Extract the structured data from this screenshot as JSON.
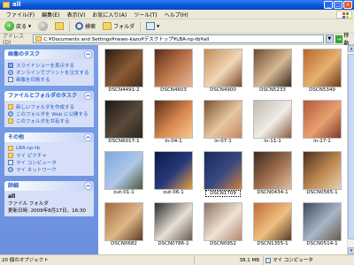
{
  "window": {
    "title": "all"
  },
  "menu": [
    "ファイル(F)",
    "編集(E)",
    "表示(V)",
    "お気に入り(A)",
    "ツール(T)",
    "ヘルプ(H)"
  ],
  "toolbar": {
    "back": "戻る",
    "search": "検索",
    "folders": "フォルダ"
  },
  "address": {
    "label": "アドレス(D)",
    "path": "C:¥Documents and Settings¥newo-kazu¥デスクトップ¥LBA-np-tb¥all",
    "go": "移動"
  },
  "sidebar": {
    "image_tasks": {
      "title": "画像のタスク",
      "items": [
        "スライドショーを表示する",
        "オンラインでプリントを注文する",
        "画像を印刷する"
      ]
    },
    "file_tasks": {
      "title": "ファイルとフォルダのタスク",
      "items": [
        "新しいフォルダを作成する",
        "このフォルダを Web に公開する",
        "このフォルダを共有する"
      ]
    },
    "other": {
      "title": "その他",
      "items": [
        "LBA-np-tb",
        "マイ ピクチャ",
        "マイ コンピュータ",
        "マイ ネットワーク"
      ]
    },
    "details": {
      "title": "詳細",
      "name": "all",
      "type": "ファイル フォルダ",
      "modified": "更新日時: 2009年8月17日、16:30"
    }
  },
  "files": [
    {
      "name": "DSCN4491-2",
      "colors": [
        "#2a1d14",
        "#8a5a34",
        "#4a2c1a"
      ]
    },
    {
      "name": "DSCN4603",
      "colors": [
        "#5a2b18",
        "#c27a4e",
        "#e2b99a"
      ]
    },
    {
      "name": "DSCN4900",
      "colors": [
        "#c28a55",
        "#f0d8b8",
        "#7a4b2a"
      ]
    },
    {
      "name": "DSCN5233",
      "colors": [
        "#6f4a30",
        "#d6b892",
        "#3a2a20"
      ]
    },
    {
      "name": "DSCN5349",
      "colors": [
        "#b7672e",
        "#e8b070",
        "#6a3a1c"
      ]
    },
    {
      "name": "DSCN6017-1",
      "colors": [
        "#1a1a1a",
        "#5a4a3a",
        "#2a2420"
      ]
    },
    {
      "name": "in-04-1",
      "colors": [
        "#5a2b18",
        "#d88a50",
        "#f4c890"
      ]
    },
    {
      "name": "in-07-1",
      "colors": [
        "#7a5030",
        "#e8c8a0",
        "#c08860"
      ]
    },
    {
      "name": "in-11-1",
      "colors": [
        "#c0b8b0",
        "#f0ece6",
        "#8a5a40"
      ]
    },
    {
      "name": "in-17-1",
      "colors": [
        "#b05a3a",
        "#e8a070",
        "#7a3a2a"
      ]
    },
    {
      "name": "out-01-1",
      "colors": [
        "#7aa8e0",
        "#b0c8e8",
        "#4a5a3a"
      ]
    },
    {
      "name": "out-06-1",
      "colors": [
        "#0a1a4a",
        "#2a3a7a",
        "#e8a040"
      ]
    },
    {
      "name": "DSCN1709",
      "colors": [
        "#1a2a5a",
        "#3a4a80",
        "#d08040"
      ]
    },
    {
      "name": "DSCN0434-1",
      "colors": [
        "#3a2a20",
        "#a07050",
        "#e0c0a0"
      ]
    },
    {
      "name": "DSCN0565-1",
      "colors": [
        "#4a3020",
        "#c08a50",
        "#e8d0b0"
      ]
    },
    {
      "name": "DSCN0682",
      "colors": [
        "#a06840",
        "#e0b888",
        "#5a3a24"
      ]
    },
    {
      "name": "DSCN0786-1",
      "colors": [
        "#2a2a2a",
        "#e8e0d8",
        "#6a5a50"
      ]
    },
    {
      "name": "DSCN0952",
      "colors": [
        "#8a7060",
        "#f0e4d6",
        "#b08870"
      ]
    },
    {
      "name": "DSCN1355-1",
      "colors": [
        "#c06a3a",
        "#f0c080",
        "#5a3a2a"
      ]
    },
    {
      "name": "DSCN0514-1",
      "colors": [
        "#3a4a5a",
        "#a8b8c8",
        "#6a5a4a"
      ]
    }
  ],
  "selected_index": 12,
  "status": {
    "count": "20 個のオブジェクト",
    "size": "38.1 MB",
    "location": "マイ コンピュータ"
  }
}
